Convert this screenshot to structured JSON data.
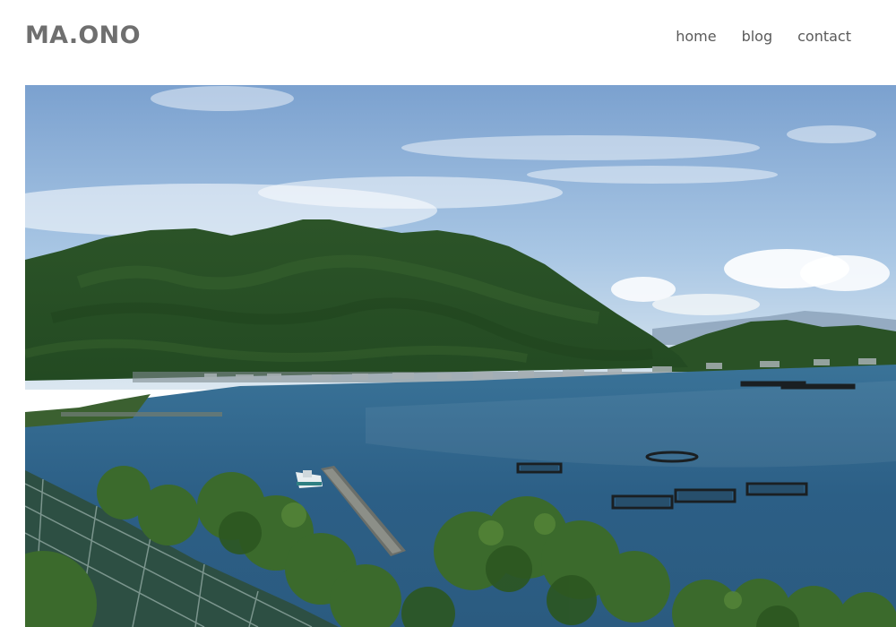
{
  "site": {
    "logo": "MA.ONO"
  },
  "nav": {
    "items": [
      {
        "label": "home"
      },
      {
        "label": "blog"
      },
      {
        "label": "contact"
      }
    ]
  },
  "hero": {
    "icon": "landscape-photo-icon",
    "colors": {
      "sky_top": "#7aa0cf",
      "sky_bottom": "#d2e2ef",
      "mountain": "#2f5a2a",
      "water": "#2c5f86",
      "foliage": "#3d6a2f"
    }
  }
}
